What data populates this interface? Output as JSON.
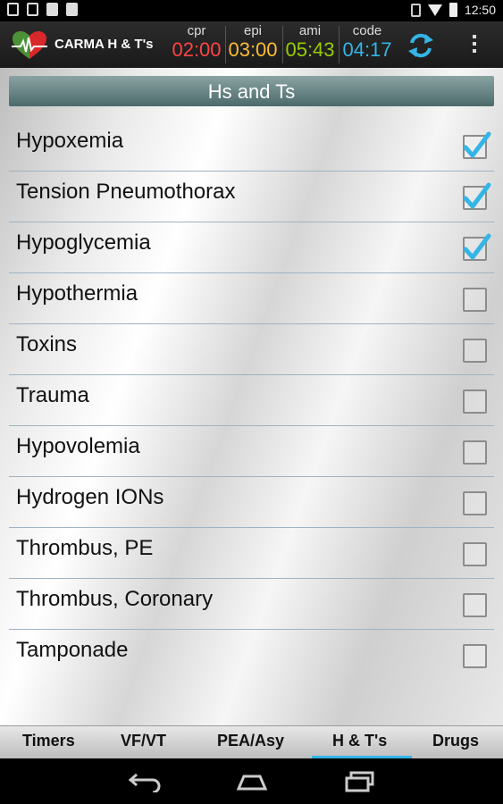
{
  "status_bar": {
    "time": "12:50",
    "icons": [
      "usb-icon",
      "image-icon",
      "sd-card-icon",
      "shop-bag-icon",
      "battery-sm-icon",
      "wifi-icon",
      "battery-icon"
    ]
  },
  "action_bar": {
    "title": "CARMA H & T's",
    "logo_icon": "heart-ecg-icon",
    "timers": [
      {
        "label": "cpr",
        "value": "02:00",
        "color": "#ff4444"
      },
      {
        "label": "epi",
        "value": "03:00",
        "color": "#ffbb33"
      },
      {
        "label": "ami",
        "value": "05:43",
        "color": "#99cc00"
      },
      {
        "label": "code",
        "value": "04:17",
        "color": "#33b5e5"
      }
    ],
    "refresh_icon": "refresh-icon",
    "overflow_icon": "overflow-menu-icon"
  },
  "list": {
    "header": "Hs and Ts",
    "items": [
      {
        "label": "Hypoxemia",
        "checked": true
      },
      {
        "label": "Tension Pneumothorax",
        "checked": true
      },
      {
        "label": "Hypoglycemia",
        "checked": true
      },
      {
        "label": "Hypothermia",
        "checked": false
      },
      {
        "label": "Toxins",
        "checked": false
      },
      {
        "label": "Trauma",
        "checked": false
      },
      {
        "label": "Hypovolemia",
        "checked": false
      },
      {
        "label": "Hydrogen IONs",
        "checked": false
      },
      {
        "label": "Thrombus, PE",
        "checked": false
      },
      {
        "label": "Thrombus, Coronary",
        "checked": false
      },
      {
        "label": "Tamponade",
        "checked": false
      }
    ]
  },
  "tabs": {
    "items": [
      "Timers",
      "VF/VT",
      "PEA/Asy",
      "H & T's",
      "Drugs"
    ],
    "selected": 3,
    "accent": "#33b5e5"
  },
  "nav_bar": {
    "icons": [
      "back-icon",
      "home-icon",
      "recent-apps-icon"
    ]
  }
}
